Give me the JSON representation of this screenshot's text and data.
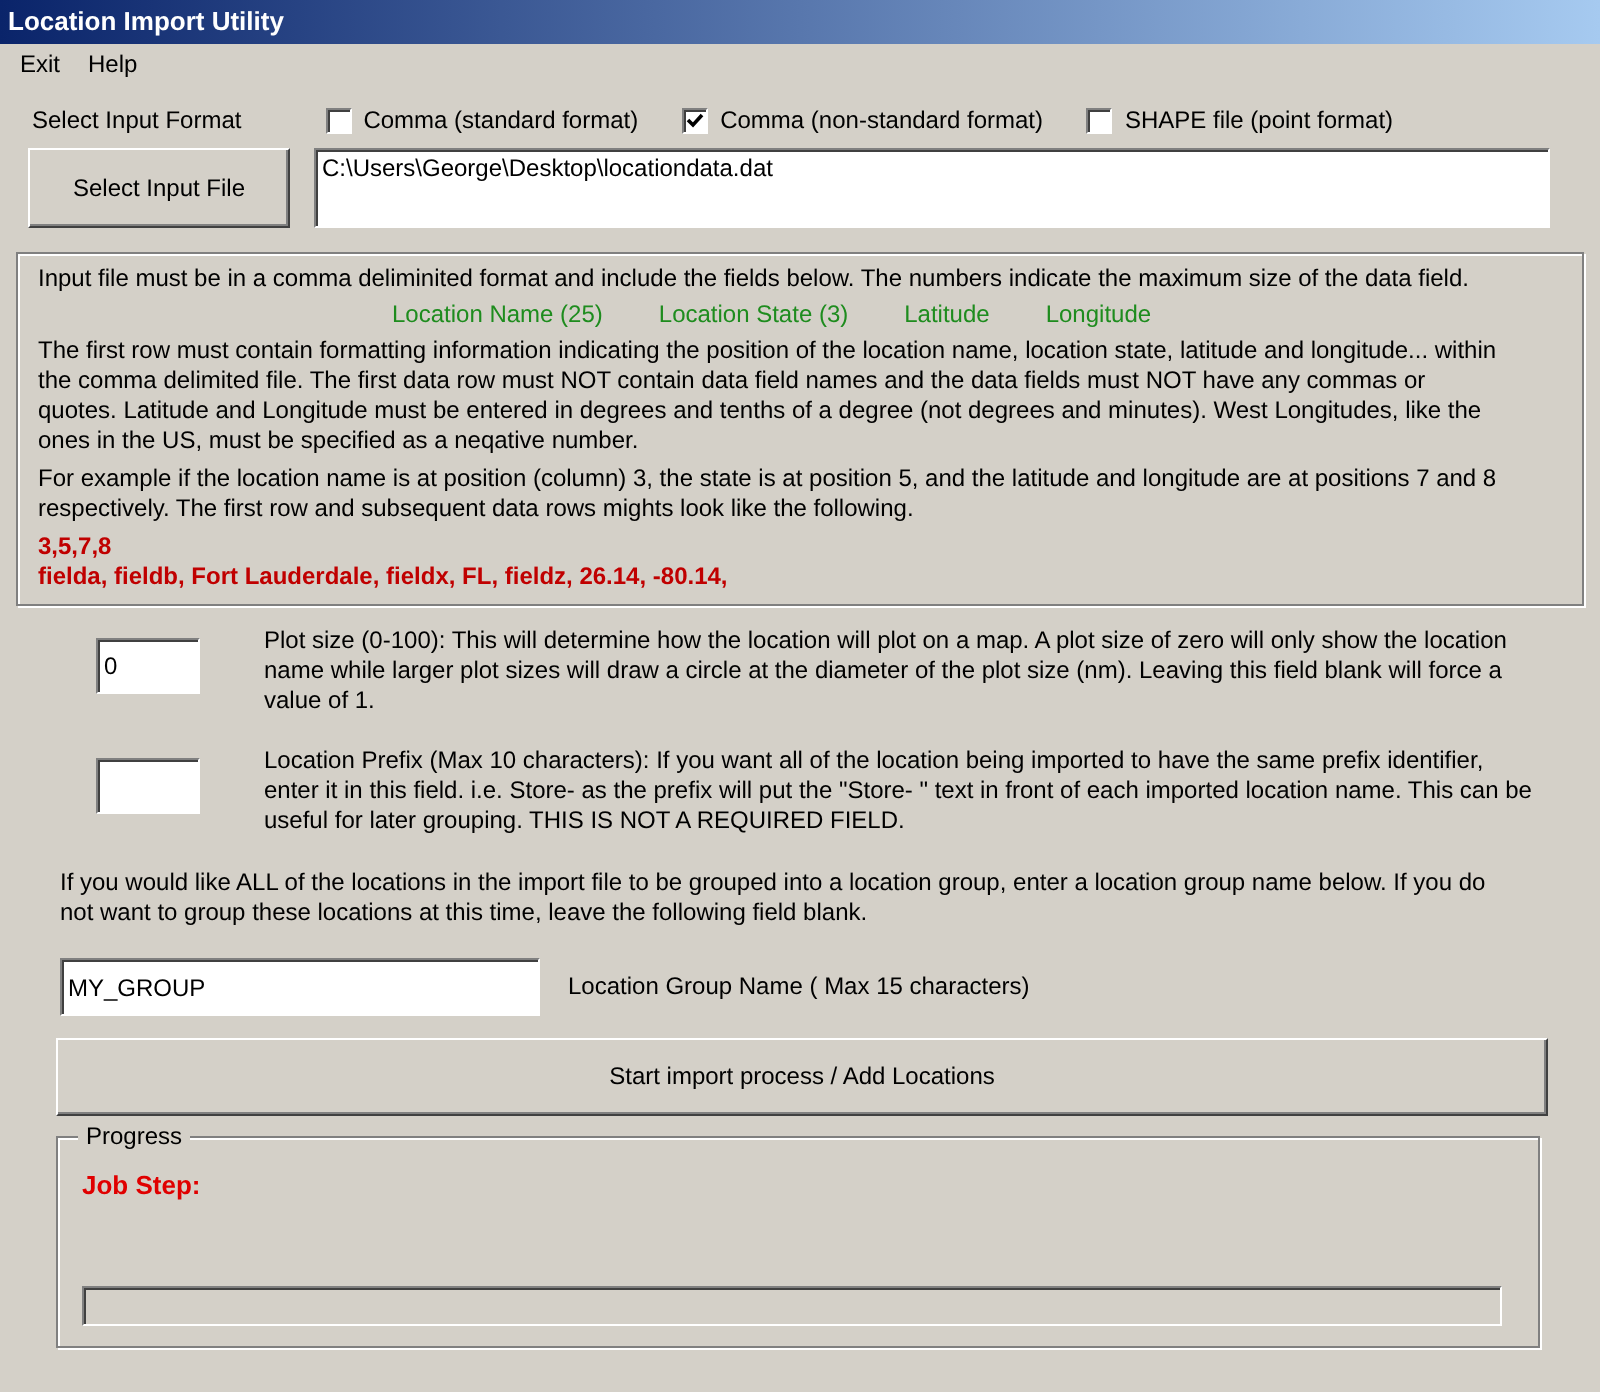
{
  "window": {
    "title": "Location Import Utility"
  },
  "menu": [
    {
      "label": "Exit"
    },
    {
      "label": "Help"
    }
  ],
  "input_format": {
    "label": "Select Input Format",
    "options": [
      {
        "label": "Comma (standard format)",
        "checked": false
      },
      {
        "label": "Comma (non-standard format)",
        "checked": true
      },
      {
        "label": "SHAPE file (point format)",
        "checked": false
      }
    ]
  },
  "select_button": "Select Input File",
  "file_path": {
    "value": "C:\\Users\\George\\Desktop\\locationdata.dat"
  },
  "instructions": {
    "intro": "Input file must be in a comma deliminited format and include the fields below.  The numbers indicate the maximum size of the data field.",
    "fields": [
      "Location Name (25)",
      "Location State (3)",
      "Latitude",
      "Longitude"
    ],
    "paragraphs": [
      "The first row must contain formatting information indicating the position of the location name, location state, latitude and longitude... within the comma delimited file.  The first data row must NOT contain data field names and the data fields must NOT have any commas or quotes.  Latitude and Longitude must be entered in degrees and tenths of a degree (not degrees and minutes).  West Longitudes, like the ones in the US, must be specified as a neqative number.",
      "For example if the location name is at position (column) 3, the state is at position 5, and the latitude and longitude are at positions 7 and 8 respectively.  The first row and subsequent data rows mights look like the following."
    ],
    "example_lines": [
      "3,5,7,8",
      "fielda, fieldb, Fort Lauderdale, fieldx, FL, fieldz, 26.14, -80.14,"
    ]
  },
  "plot_size": {
    "value": "0",
    "description": "Plot size (0-100):  This will determine how the location will plot on a map.  A plot size of zero will only show the location name while larger plot sizes will draw a circle at the diameter of the plot size (nm).  Leaving this field blank will force a value of 1."
  },
  "prefix": {
    "description": "Location Prefix (Max 10 characters):  If you want all of the location being imported to have the same prefix identifier, enter it in this field.  i.e. Store- as the prefix will put the \"Store- \" text in front of each imported location name.  This can be useful for later grouping.  THIS IS NOT A REQUIRED FIELD."
  },
  "group_note": "If you would like ALL of the locations in the import file to be grouped into a location group, enter a location group name below.  If you do not want to group these locations at this time, leave the following field blank.",
  "group_name": {
    "value": "MY_GROUP",
    "label": "Location Group Name ( Max 15 characters)"
  },
  "start_button": "Start import process / Add Locations",
  "progress": {
    "title": "Progress",
    "job_step": "Job Step:",
    "level": 0
  }
}
